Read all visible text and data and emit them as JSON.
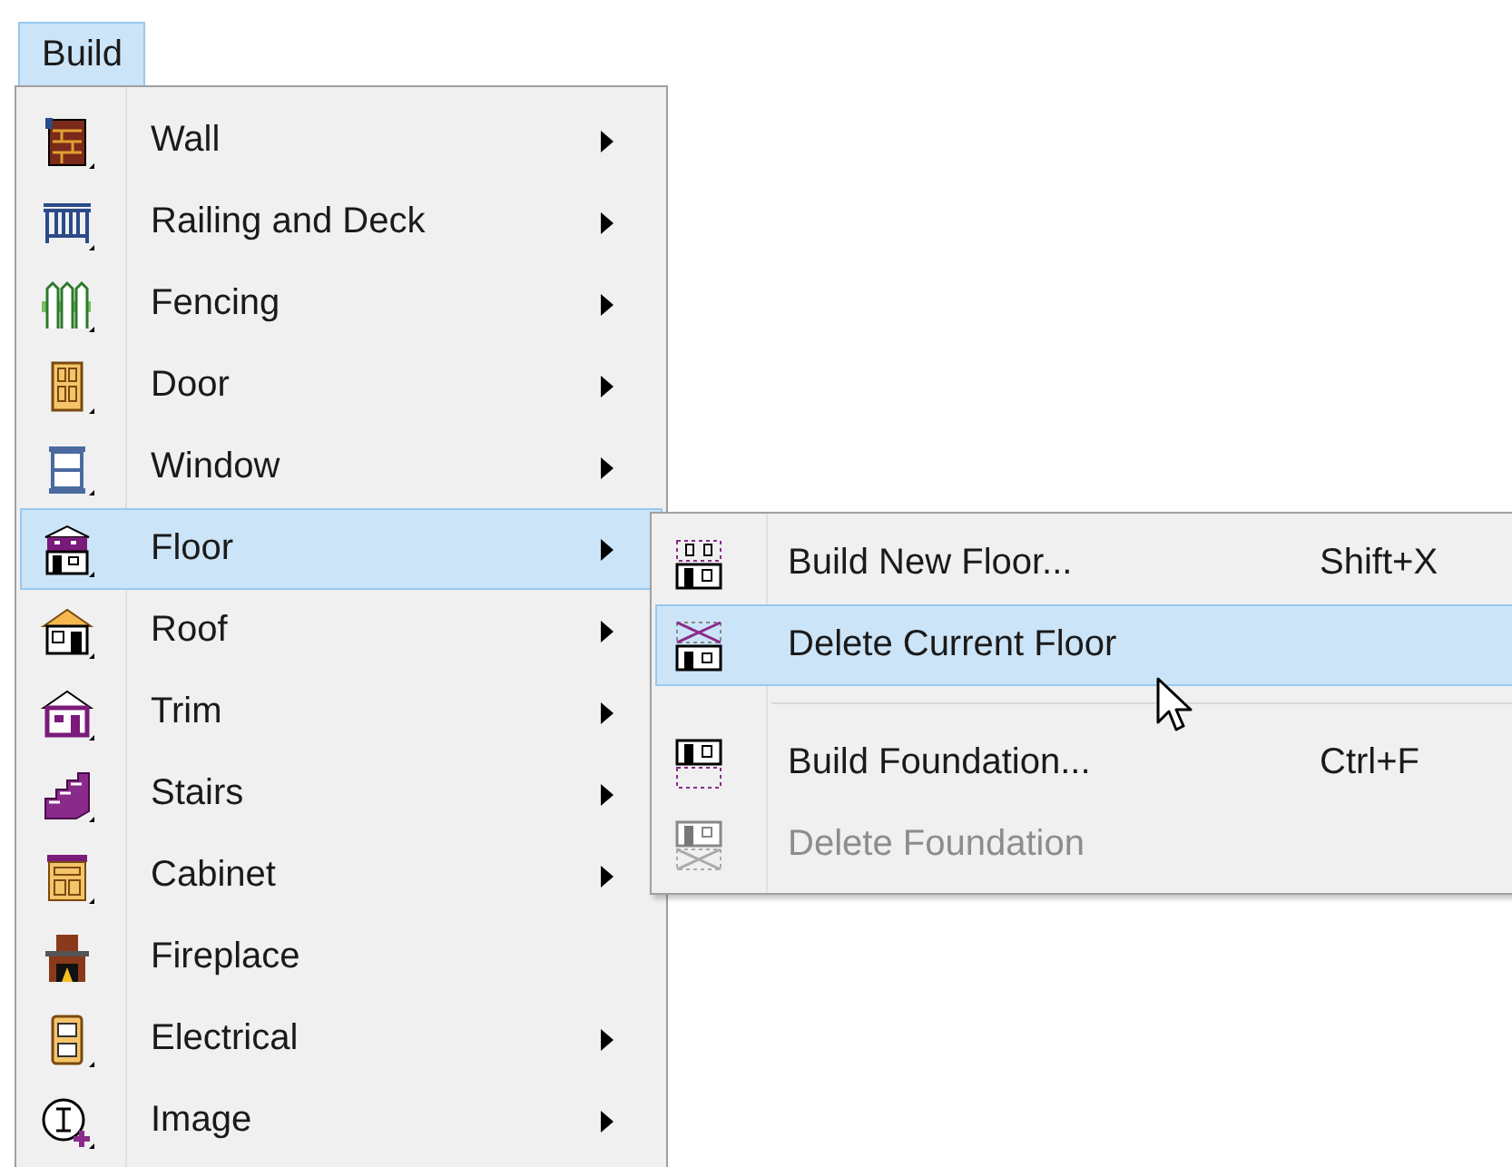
{
  "menubar": [
    {
      "label": "Build",
      "selected": true
    }
  ],
  "menu": {
    "items": [
      {
        "label": "Wall",
        "has_submenu": true,
        "selected": false
      },
      {
        "label": "Railing and Deck",
        "has_submenu": true,
        "selected": false
      },
      {
        "label": "Fencing",
        "has_submenu": true,
        "selected": false
      },
      {
        "label": "Door",
        "has_submenu": true,
        "selected": false
      },
      {
        "label": "Window",
        "has_submenu": true,
        "selected": false
      },
      {
        "label": "Floor",
        "has_submenu": true,
        "selected": true
      },
      {
        "label": "Roof",
        "has_submenu": true,
        "selected": false
      },
      {
        "label": "Trim",
        "has_submenu": true,
        "selected": false
      },
      {
        "label": "Stairs",
        "has_submenu": true,
        "selected": false
      },
      {
        "label": "Cabinet",
        "has_submenu": true,
        "selected": false
      },
      {
        "label": "Fireplace",
        "has_submenu": false,
        "selected": false
      },
      {
        "label": "Electrical",
        "has_submenu": true,
        "selected": false
      },
      {
        "label": "Image",
        "has_submenu": true,
        "selected": false
      }
    ]
  },
  "submenu": {
    "items": [
      {
        "kind": "command",
        "label": "Build New Floor...",
        "shortcut": "Shift+X",
        "selected": false,
        "disabled": false
      },
      {
        "kind": "command",
        "label": "Delete Current Floor",
        "selected": true,
        "disabled": false
      },
      {
        "kind": "separator"
      },
      {
        "kind": "command",
        "label": "Build Foundation...",
        "shortcut": "Ctrl+F",
        "selected": false,
        "disabled": false
      },
      {
        "kind": "command",
        "label": "Delete Foundation",
        "selected": false,
        "disabled": true
      }
    ]
  }
}
